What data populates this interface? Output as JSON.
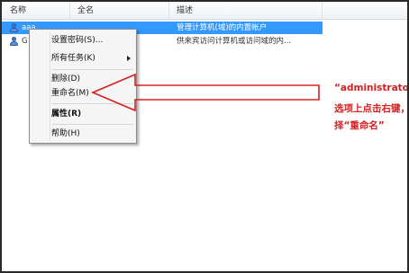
{
  "columns": {
    "name": "名称",
    "fullname": "全名",
    "description": "描述"
  },
  "rows": [
    {
      "name": "aaa",
      "fullname": "",
      "description": "管理计算机(域)的内置帐户",
      "icon": "user-icon",
      "selected": true
    },
    {
      "name": "G",
      "fullname": "",
      "description": "供来宾访问计算机或访问域的内...",
      "icon": "user-icon",
      "selected": false
    }
  ],
  "context_menu": {
    "items": [
      {
        "label": "设置密码(S)..."
      },
      {
        "label": "所有任务(K)",
        "submenu": true
      },
      {
        "label": "删除(D)"
      },
      {
        "label": "重命名(M)"
      },
      {
        "label": "属性(R)",
        "bold": true
      },
      {
        "label": "帮助(H)"
      }
    ]
  },
  "annotation": {
    "line1": "“administrator”",
    "line2": "选项上点击右键，",
    "line3": "择“重命名”",
    "color": "#d62020"
  },
  "colors": {
    "selection": "#3399ff",
    "arrow": "#d62020"
  }
}
